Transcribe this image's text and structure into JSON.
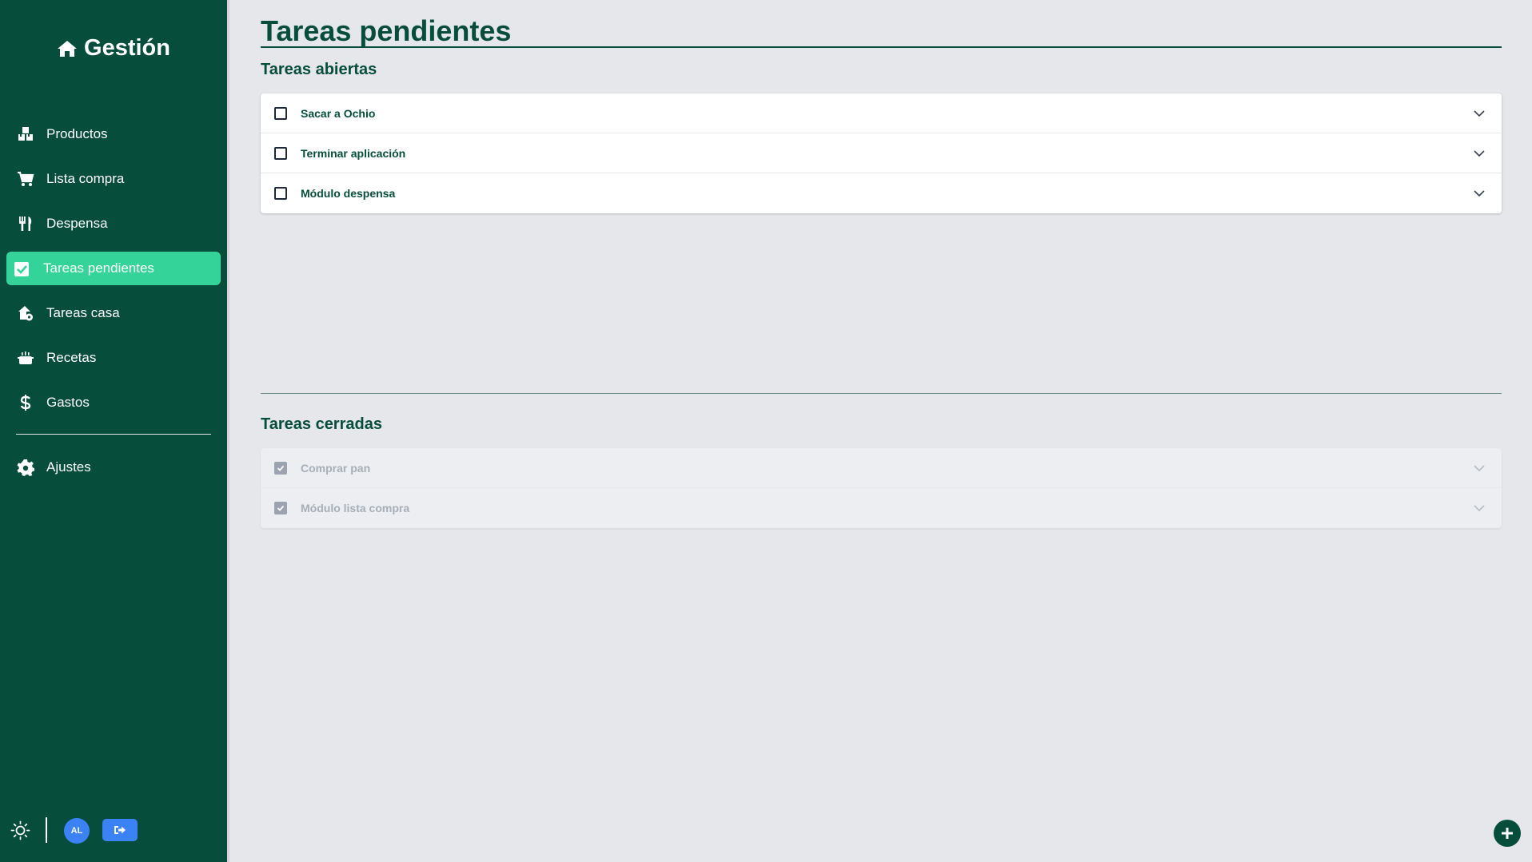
{
  "app": {
    "brand": "Gestión"
  },
  "sidebar": {
    "items": [
      {
        "label": "Productos",
        "icon": "boxes-icon"
      },
      {
        "label": "Lista compra",
        "icon": "cart-icon"
      },
      {
        "label": "Despensa",
        "icon": "utensils-icon"
      },
      {
        "label": "Tareas pendientes",
        "icon": "check-square-icon",
        "active": true
      },
      {
        "label": "Tareas casa",
        "icon": "house-gear-icon"
      },
      {
        "label": "Recetas",
        "icon": "pot-icon"
      },
      {
        "label": "Gastos",
        "icon": "dollar-icon"
      }
    ],
    "settings": {
      "label": "Ajustes",
      "icon": "gear-icon"
    },
    "footer": {
      "avatar_initials": "AL",
      "theme_icon": "sun-icon",
      "logout_icon": "logout-icon"
    }
  },
  "main": {
    "title": "Tareas pendientes",
    "open_section": {
      "title": "Tareas abiertas",
      "tasks": [
        {
          "label": "Sacar a Ochio",
          "done": false
        },
        {
          "label": "Terminar aplicación",
          "done": false
        },
        {
          "label": "Módulo despensa",
          "done": false
        }
      ]
    },
    "closed_section": {
      "title": "Tareas cerradas",
      "tasks": [
        {
          "label": "Comprar pan",
          "done": true
        },
        {
          "label": "Módulo lista compra",
          "done": true
        }
      ]
    }
  },
  "colors": {
    "sidebar_bg": "#064e3b",
    "active_bg": "#34d399",
    "page_bg": "#e5e7eb",
    "accent_blue": "#3b82f6"
  }
}
